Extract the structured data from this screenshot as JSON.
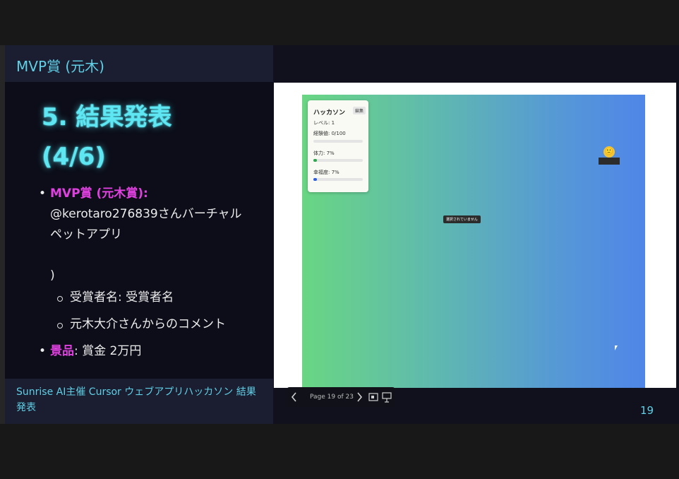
{
  "slide": {
    "header_title": "MVP賞 (元木)",
    "heading_line1": "5. 結果発表",
    "heading_line2": "(4/6)",
    "bullet1": {
      "label": "MVP賞 (元木賞):",
      "text_line1": "@kerotaro276839さんバーチャル",
      "text_line2": "ペットアプリ",
      "text_line3": ")"
    },
    "sub_items": [
      "受賞者名: 受賞者名",
      "元木大介さんからのコメント"
    ],
    "bullet2": {
      "label": "景品",
      "text": ": 賞金 2万円"
    },
    "footer": "Sunrise AI主催 Cursor ウェブアプリハッカソン 結果発表",
    "page_number": "19"
  },
  "app_screenshot": {
    "card_title": "ハッカソン",
    "edit_button": "編集",
    "level": "レベル: 1",
    "experience": "経験値: 0/100",
    "stamina": "体力: 7%",
    "happiness": "幸福度: 7%",
    "stamina_value": 0.07,
    "happiness_value": 0.07,
    "tooltip": "選択されていません",
    "pet_emoji": "🙂",
    "colors": {
      "gradient_start": "#69d683",
      "gradient_end": "#4f86e8",
      "stamina_fill": "#2fa84f",
      "happiness_fill": "#2f5fe0"
    }
  },
  "viewer": {
    "page_label": "Page 19 of 23",
    "prev_icon": "chevron-left-icon",
    "next_icon": "chevron-right-icon"
  },
  "colors": {
    "accent_cyan": "#5fd0e6",
    "accent_magenta": "#e040e0"
  }
}
